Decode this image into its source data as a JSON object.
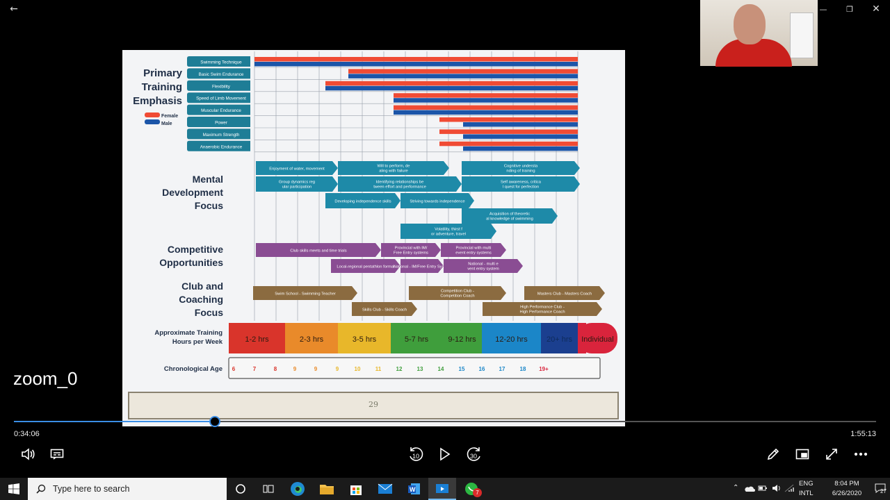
{
  "window": {
    "back_glyph": "←",
    "minimize_glyph": "—",
    "maximize_glyph": "❐",
    "close_glyph": "✕"
  },
  "video": {
    "overlay_title": "zoom_0",
    "current_time": "0:34:06",
    "total_time": "1:55:13",
    "progress_fraction": 0.233,
    "skip_back_seconds": "10",
    "skip_forward_seconds": "30"
  },
  "slide": {
    "page_number": "29",
    "primary_heading": [
      "Primary",
      "Training",
      "Emphasis"
    ],
    "legend": {
      "female": "Female",
      "male": "Male",
      "female_color": "#f04b34",
      "male_color": "#1b55a8"
    },
    "primary_rows": [
      "Swimming Technique",
      "Basic Swim Endurance",
      "Flexibility",
      "Speed of Limb Movement",
      "Muscular Endurance",
      "Power",
      "Maximum Strength",
      "Anaerobic Endurance"
    ],
    "mental_heading": [
      "Mental",
      "Development",
      "Focus"
    ],
    "mental_items": [
      "Enjoyment of water, movement",
      "Will to perform, dealing with failure",
      "Cognitive understanding of training",
      "Group dynamics regular participation",
      "Identifying relationships between effort and performance",
      "Self awareness, critical quest for perfection",
      "Developing independence skills",
      "Striving towards independence",
      "Acquisition of theoretical knowledge of swimming",
      "Volatility, thirst for adventure, travel"
    ],
    "competitive_heading": [
      "Competitive",
      "Opportunities"
    ],
    "competitive_items": [
      "Club skills meets and time trials",
      "Provincial with IM/Free Entry systems",
      "Provincial with multi event entry systems",
      "Local-regional pentathlon format",
      "National - IM/Free Entry System",
      "National - multi event entry system"
    ],
    "coaching_heading": [
      "Club and",
      "Coaching",
      "Focus"
    ],
    "coaching_items": [
      "Swim School - Swimming Teacher",
      "Competition Club - Competition Coach",
      "Masters Club - Masters Coach",
      "Skills Club - Skills Coach",
      "High Performance Club - High Performance Coach"
    ],
    "hours_heading": [
      "Approximate Training",
      "Hours per Week"
    ],
    "hours_bands": [
      {
        "label": "1-2 hrs",
        "color": "#d9342b"
      },
      {
        "label": "2-3 hrs",
        "color": "#e98a2a"
      },
      {
        "label": "3-5 hrs",
        "color": "#e8b72a"
      },
      {
        "label": "5-7 hrs",
        "color": "#3f9e3c"
      },
      {
        "label": "9-12 hrs",
        "color": "#3f9e3c"
      },
      {
        "label": "12-20 hrs",
        "color": "#1b86c8"
      },
      {
        "label": "20+ hrs",
        "color": "#1b3f8f"
      },
      {
        "label": "Individual",
        "color": "#d9243c"
      }
    ],
    "age_heading": "Chronological Age",
    "ages": [
      "6",
      "7",
      "8",
      "9",
      "9",
      "9",
      "10",
      "11",
      "12",
      "13",
      "14",
      "15",
      "16",
      "17",
      "18",
      "19+"
    ]
  },
  "taskbar": {
    "search_placeholder": "Type here to search",
    "whatsapp_badge": "7",
    "language": "ENG",
    "layout": "INTL",
    "clock_time": "8:04 PM",
    "clock_date": "6/26/2020",
    "notification_count": "27"
  }
}
